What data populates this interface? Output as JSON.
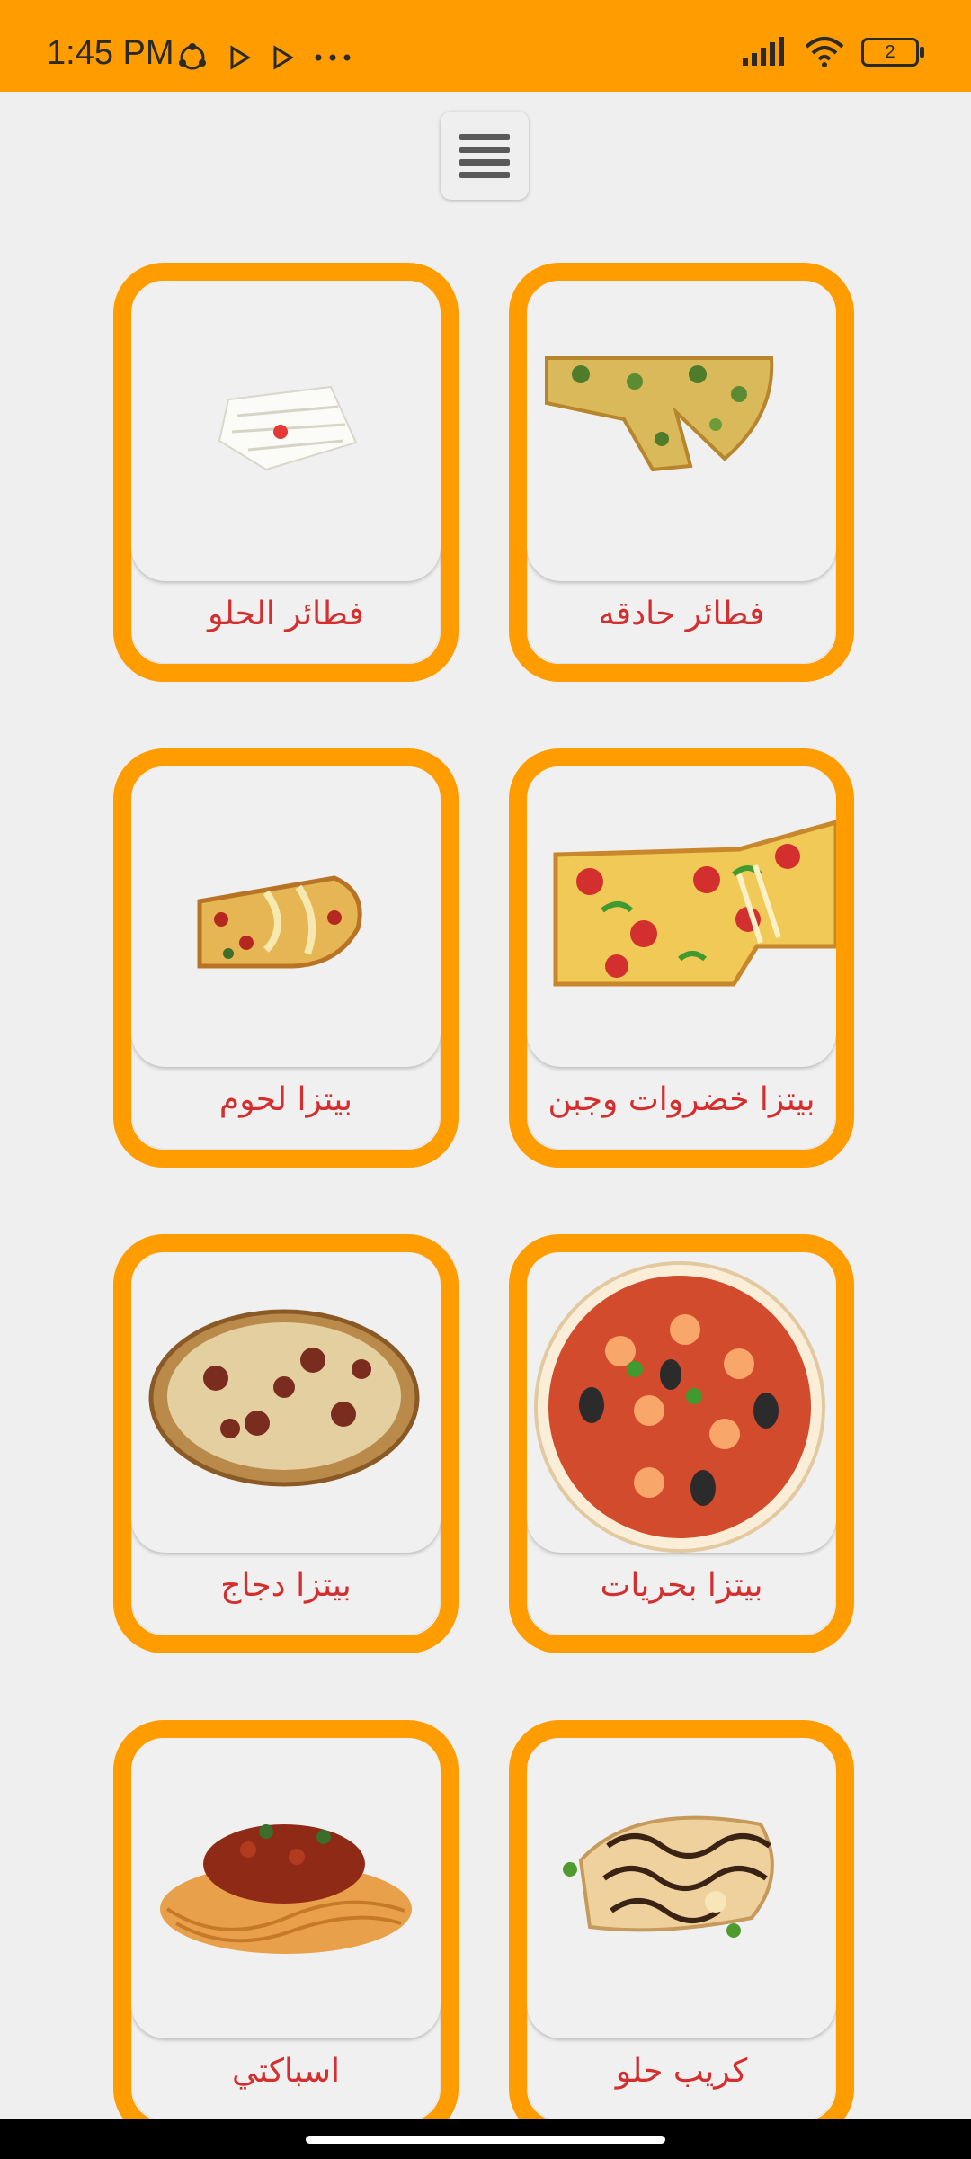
{
  "status_bar": {
    "time": "1:45 PM",
    "battery_level": "2",
    "icons": [
      "sync-icon",
      "play-icon",
      "play-icon",
      "more-icon",
      "signal-icon",
      "wifi-icon",
      "battery-icon"
    ]
  },
  "menu": {
    "icon": "hamburger-menu-icon"
  },
  "categories": [
    {
      "label": "فطائر الحلو",
      "icon": "sweet-pie-image"
    },
    {
      "label": "فطائر حادقه",
      "icon": "savory-pie-image"
    },
    {
      "label": "بيتزا لحوم",
      "icon": "meat-pizza-image"
    },
    {
      "label": "بيتزا خضروات وجبن",
      "icon": "veggie-cheese-pizza-image"
    },
    {
      "label": "بيتزا دجاج",
      "icon": "chicken-pizza-image"
    },
    {
      "label": "بيتزا بحريات",
      "icon": "seafood-pizza-image"
    },
    {
      "label": "اسباكتي",
      "icon": "spaghetti-image"
    },
    {
      "label": "كريب حلو",
      "icon": "sweet-crepe-image"
    }
  ],
  "colors": {
    "accent": "#ff9d00",
    "label": "#d32f2f",
    "background": "#efefef"
  }
}
